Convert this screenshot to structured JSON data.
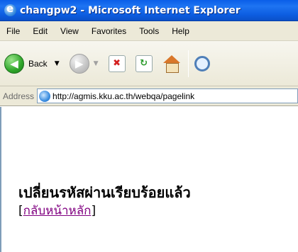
{
  "window": {
    "title": "changpw2 - Microsoft Internet Explorer"
  },
  "menubar": {
    "items": [
      "File",
      "Edit",
      "View",
      "Favorites",
      "Tools",
      "Help"
    ]
  },
  "toolbar": {
    "back_label": "Back",
    "icons": [
      "back-arrow-icon",
      "forward-arrow-icon",
      "stop-icon",
      "refresh-icon",
      "home-icon",
      "search-icon"
    ]
  },
  "addressbar": {
    "label": "Address",
    "url": "http://agmis.kku.ac.th/webqa/pagelink"
  },
  "page": {
    "heading": "เปลี่ยนรหัสผ่านเรียบร้อยแล้ว",
    "bracket_open": "[",
    "home_link": "กลับหน้าหลัก",
    "bracket_close": "]"
  },
  "colors": {
    "titlebar": "#0a5ee8",
    "chrome": "#ece9d8",
    "visited_link": "#800080"
  }
}
